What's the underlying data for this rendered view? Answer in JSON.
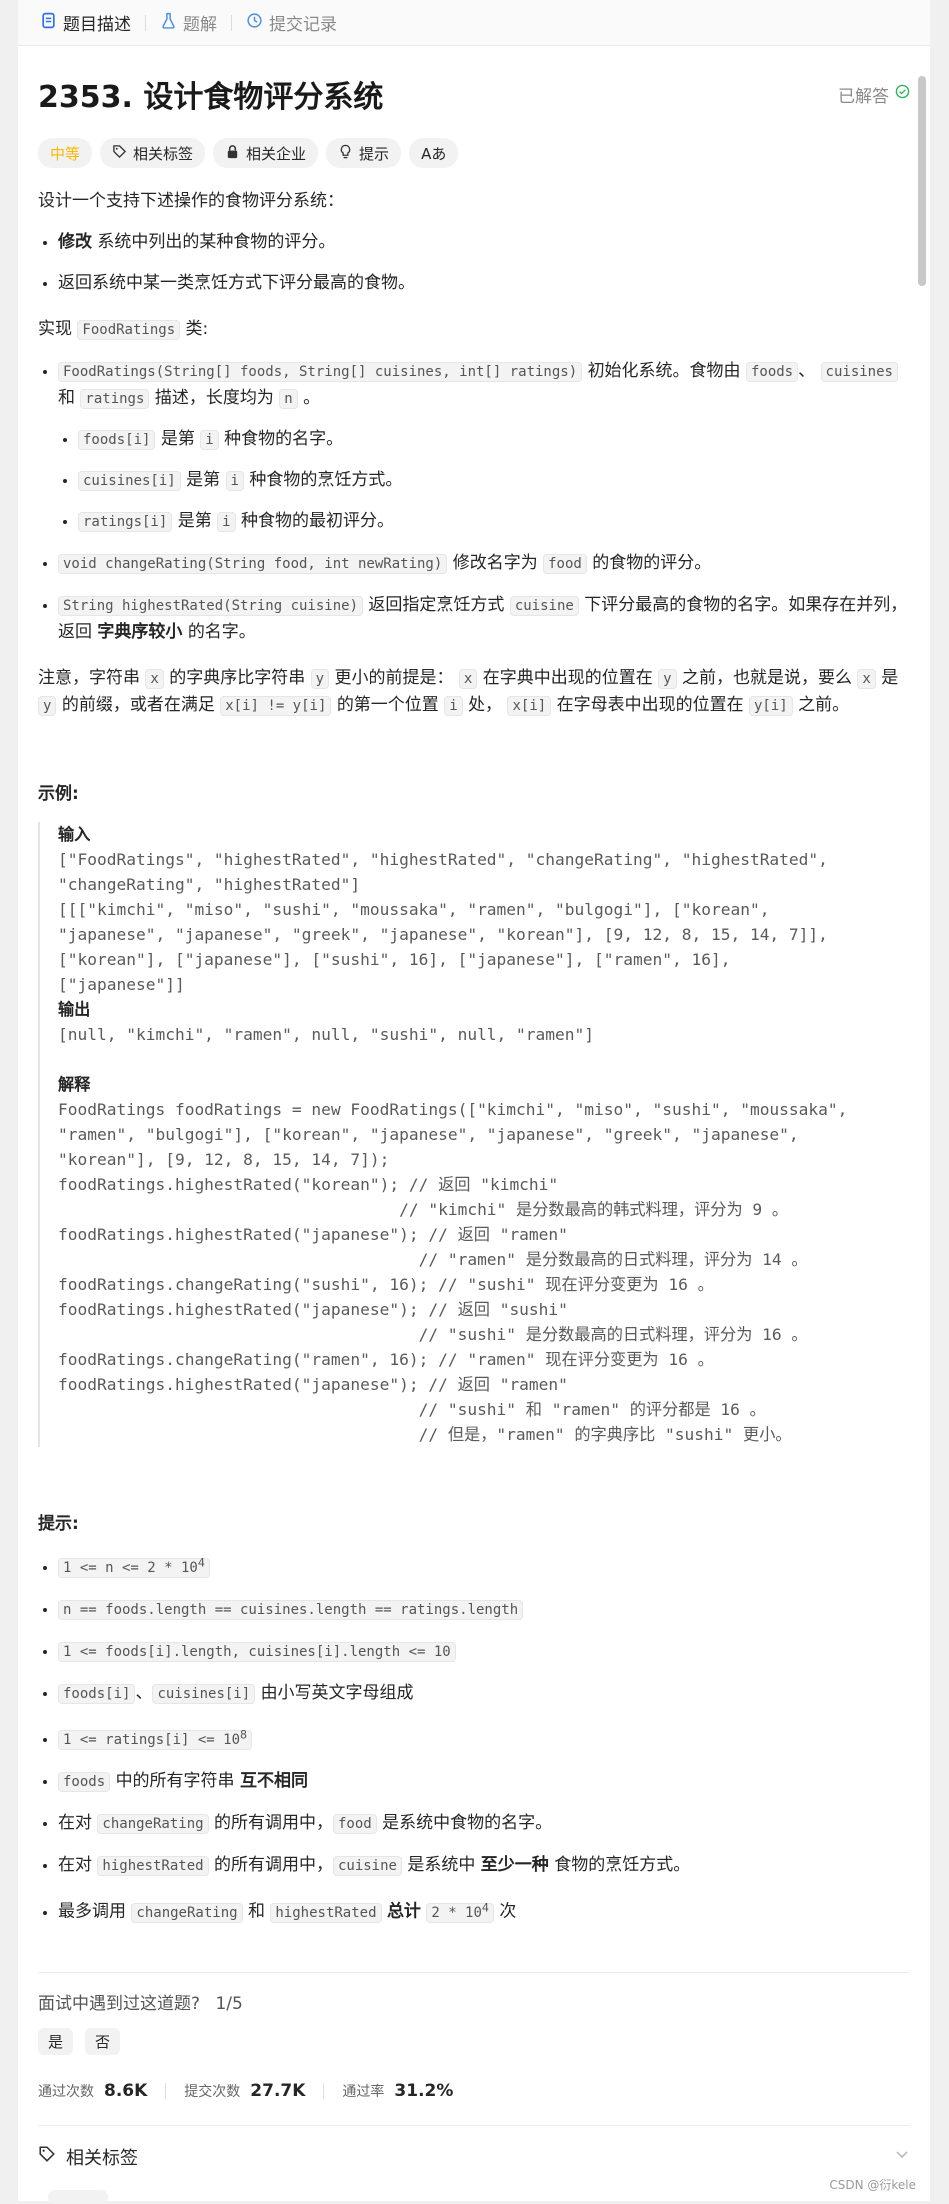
{
  "tabs": [
    {
      "label": "题目描述",
      "icon": "document-icon"
    },
    {
      "label": "题解",
      "icon": "flask-icon"
    },
    {
      "label": "提交记录",
      "icon": "history-icon"
    }
  ],
  "problem": {
    "title": "2353. 设计食物评分系统",
    "status": "已解答",
    "tags": [
      "中等",
      "相关标签",
      "相关企业",
      "提示",
      "Aあ"
    ]
  },
  "description": {
    "intro": "设计一个支持下述操作的食物评分系统：",
    "op1_bold": "修改",
    "op1_rest": "系统中列出的某种食物的评分。",
    "op2": "返回系统中某一类烹饪方式下评分最高的食物。",
    "impl_prefix": "实现",
    "impl_class": "FoodRatings",
    "impl_suffix": "类:",
    "ctor_code": "FoodRatings(String[] foods, String[] cuisines, int[] ratings)",
    "ctor_text1": "初始化系统。食物由",
    "ctor_foods": "foods",
    "ctor_sep": "、",
    "ctor_cuisines": "cuisines",
    "ctor_and": "和",
    "ctor_ratings": "ratings",
    "ctor_text2": "描述，长度均为",
    "ctor_n": "n",
    "ctor_end": "。",
    "sub1_code": "foods[i]",
    "sub1_a": "是第",
    "sub1_i": "i",
    "sub1_b": "种食物的名字。",
    "sub2_code": "cuisines[i]",
    "sub2_a": "是第",
    "sub2_i": "i",
    "sub2_b": "种食物的烹饪方式。",
    "sub3_code": "ratings[i]",
    "sub3_a": "是第",
    "sub3_i": "i",
    "sub3_b": "种食物的最初评分。",
    "m1_code": "void changeRating(String food, int newRating)",
    "m1_a": "修改名字为",
    "m1_food": "food",
    "m1_b": "的食物的评分。",
    "m2_code": "String highestRated(String cuisine)",
    "m2_a": "返回指定烹饪方式",
    "m2_cuisine": "cuisine",
    "m2_b": "下评分最高的食物的名字。如果存在并列，返回",
    "m2_bold": "字典序较小",
    "m2_c": "的名字。",
    "note_a": "注意，字符串",
    "note_x": "x",
    "note_b": "的字典序比字符串",
    "note_y": "y",
    "note_c": "更小的前提是：",
    "note_x2": "x",
    "note_d": "在字典中出现的位置在",
    "note_y2": "y",
    "note_e": "之前，也就是说，要么",
    "note_x3": "x",
    "note_f": "是",
    "note_y3": "y",
    "note_g": "的前缀，或者在满足",
    "note_cond": "x[i] != y[i]",
    "note_h": "的第一个位置",
    "note_i": "i",
    "note_j": "处，",
    "note_xi": "x[i]",
    "note_k": "在字母表中出现的位置在",
    "note_yi": "y[i]",
    "note_l": "之前。"
  },
  "example": {
    "heading": "示例:",
    "input_label": "输入",
    "input_text": "[\"FoodRatings\", \"highestRated\", \"highestRated\", \"changeRating\", \"highestRated\",\n\"changeRating\", \"highestRated\"]\n[[[\"kimchi\", \"miso\", \"sushi\", \"moussaka\", \"ramen\", \"bulgogi\"], [\"korean\",\n\"japanese\", \"japanese\", \"greek\", \"japanese\", \"korean\"], [9, 12, 8, 15, 14, 7]],\n[\"korean\"], [\"japanese\"], [\"sushi\", 16], [\"japanese\"], [\"ramen\", 16],\n[\"japanese\"]]",
    "output_label": "输出",
    "output_text": "[null, \"kimchi\", \"ramen\", null, \"sushi\", null, \"ramen\"]",
    "explain_label": "解释",
    "explain_text": "FoodRatings foodRatings = new FoodRatings([\"kimchi\", \"miso\", \"sushi\", \"moussaka\",\n\"ramen\", \"bulgogi\"], [\"korean\", \"japanese\", \"japanese\", \"greek\", \"japanese\",\n\"korean\"], [9, 12, 8, 15, 14, 7]);\nfoodRatings.highestRated(\"korean\"); // 返回 \"kimchi\"\n                                   // \"kimchi\" 是分数最高的韩式料理，评分为 9 。\nfoodRatings.highestRated(\"japanese\"); // 返回 \"ramen\"\n                                     // \"ramen\" 是分数最高的日式料理，评分为 14 。\nfoodRatings.changeRating(\"sushi\", 16); // \"sushi\" 现在评分变更为 16 。\nfoodRatings.highestRated(\"japanese\"); // 返回 \"sushi\"\n                                     // \"sushi\" 是分数最高的日式料理，评分为 16 。\nfoodRatings.changeRating(\"ramen\", 16); // \"ramen\" 现在评分变更为 16 。\nfoodRatings.highestRated(\"japanese\"); // 返回 \"ramen\"\n                                     // \"sushi\" 和 \"ramen\" 的评分都是 16 。\n                                     // 但是，\"ramen\" 的字典序比 \"sushi\" 更小。"
  },
  "constraints": {
    "heading": "提示:",
    "c1_pre": "1 <= n <= 2 * 10",
    "c1_sup": "4",
    "c2": "n == foods.length == cuisines.length == ratings.length",
    "c3": "1 <= foods[i].length, cuisines[i].length <= 10",
    "c4_code1": "foods[i]",
    "c4_sep": "、",
    "c4_code2": "cuisines[i]",
    "c4_text": "由小写英文字母组成",
    "c5_pre": "1 <= ratings[i] <= 10",
    "c5_sup": "8",
    "c6_code": "foods",
    "c6_text": "中的所有字符串",
    "c6_bold": "互不相同",
    "c7_a": "在对",
    "c7_code": "changeRating",
    "c7_b": "的所有调用中，",
    "c7_food": "food",
    "c7_c": "是系统中食物的名字。",
    "c8_a": "在对",
    "c8_code": "highestRated",
    "c8_b": "的所有调用中，",
    "c8_cuisine": "cuisine",
    "c8_c": "是系统中",
    "c8_bold": "至少一种",
    "c8_d": "食物的烹饪方式。",
    "c9_a": "最多调用",
    "c9_code1": "changeRating",
    "c9_and": "和",
    "c9_code2": "highestRated",
    "c9_bold": "总计",
    "c9_num": "2 * 10",
    "c9_sup": "4",
    "c9_end": "次"
  },
  "footer": {
    "question": "面试中遇到过这道题?",
    "progress": "1/5",
    "yes": "是",
    "no": "否",
    "accepted_label": "通过次数",
    "accepted_value": "8.6K",
    "submissions_label": "提交次数",
    "submissions_value": "27.7K",
    "rate_label": "通过率",
    "rate_value": "31.2%",
    "related_tags": "相关标签",
    "watermark": "CSDN @衍kele"
  },
  "colors": {
    "difficulty": "#ffb800",
    "solved_icon": "#2db55d"
  }
}
